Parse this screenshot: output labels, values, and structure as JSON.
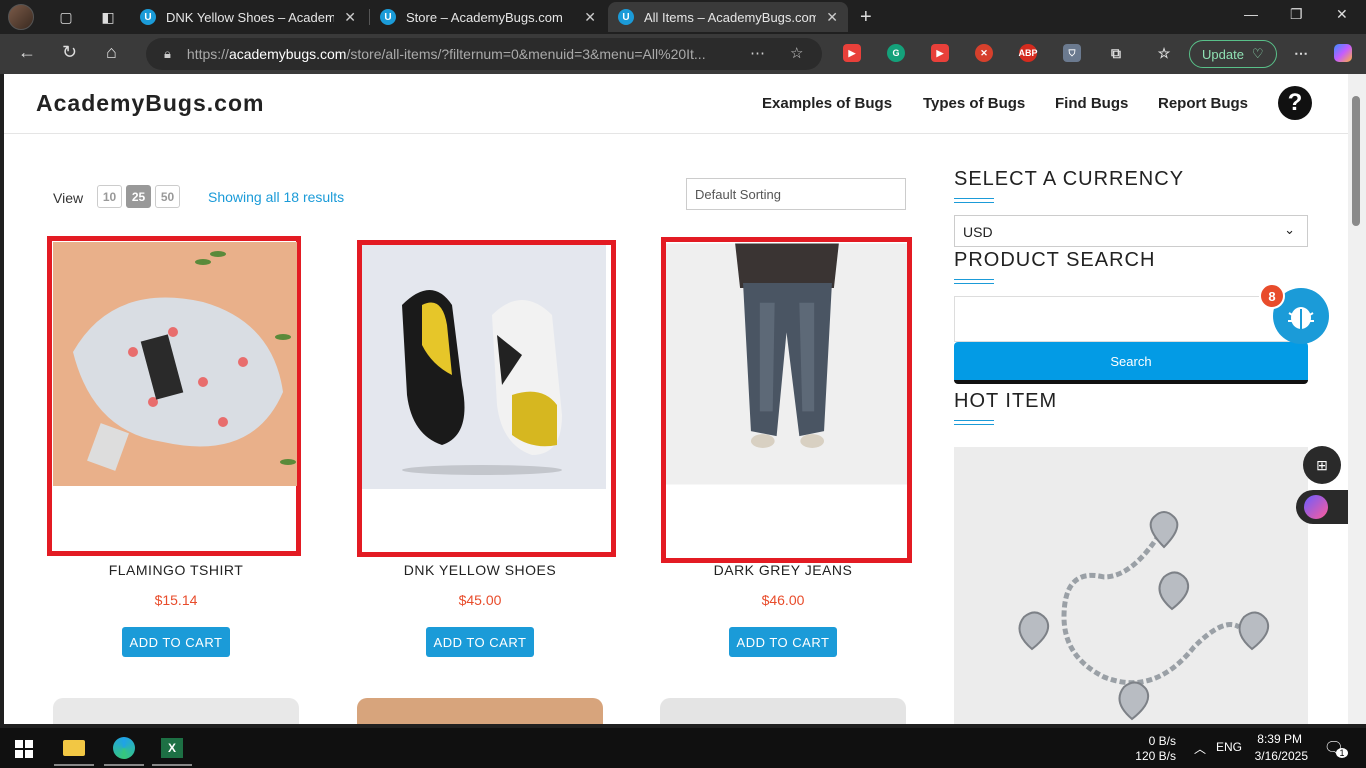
{
  "browser": {
    "tabs": [
      {
        "label": "DNK Yellow Shoes – AcademyBugs.com",
        "favicon": "U"
      },
      {
        "label": "Store – AcademyBugs.com",
        "favicon": "U"
      },
      {
        "label": "All Items – AcademyBugs.com",
        "favicon": "U"
      }
    ],
    "url_prefix": "https://",
    "url_host": "academybugs.com",
    "url_path": "/store/all-items/?filternum=0&menuid=3&menu=All%20It...",
    "update_label": "Update",
    "extensions": [
      "ABP"
    ]
  },
  "site": {
    "logo": "AcademyBugs.com",
    "menu": [
      "Examples of Bugs",
      "Types of Bugs",
      "Find Bugs",
      "Report Bugs"
    ],
    "help_glyph": "?"
  },
  "listing": {
    "view_label": "View",
    "view_options": [
      "10",
      "25",
      "50"
    ],
    "view_selected": "25",
    "showing_text": "Showing all 18 results",
    "sorting": "Default Sorting"
  },
  "products": [
    {
      "title": "FLAMINGO TSHIRT",
      "price": "$15.14",
      "cart_label": "ADD TO CART"
    },
    {
      "title": "DNK YELLOW SHOES",
      "price": "$45.00",
      "cart_label": "ADD TO CART"
    },
    {
      "title": "DARK GREY JEANS",
      "price": "$46.00",
      "cart_label": "ADD TO CART"
    }
  ],
  "sidebar": {
    "currency_heading": "SELECT A CURRENCY",
    "currency_value": "USD",
    "search_heading": "PRODUCT SEARCH",
    "search_button": "Search",
    "hot_heading": "HOT ITEM"
  },
  "widget": {
    "badge": "8"
  },
  "taskbar": {
    "net_up": "0 B/s",
    "net_down": "120 B/s",
    "lang": "ENG",
    "time": "8:39 PM",
    "date": "3/16/2025",
    "notif_count": "1"
  },
  "colors": {
    "accent": "#1b9bd8",
    "price": "#e84c2b",
    "highlight": "#e31b23"
  }
}
